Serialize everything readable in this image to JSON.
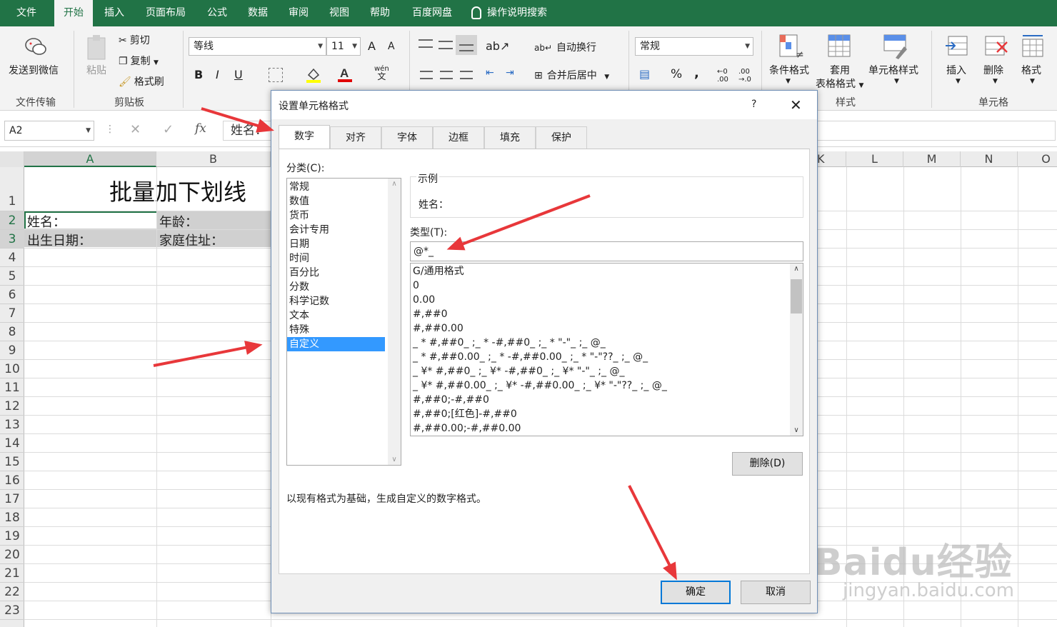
{
  "ribbon_tabs": [
    "文件",
    "开始",
    "插入",
    "页面布局",
    "公式",
    "数据",
    "审阅",
    "视图",
    "帮助",
    "百度网盘"
  ],
  "search_label": "操作说明搜索",
  "groups": {
    "file_transfer": {
      "button": "发送到微信",
      "label": "文件传输"
    },
    "clipboard": {
      "paste": "粘贴",
      "cut": "剪切",
      "copy": "复制",
      "format_painter": "格式刷",
      "label": "剪贴板"
    },
    "font": {
      "name": "等线",
      "size": "11",
      "bold": "B",
      "italic": "I",
      "underline": "U",
      "grow": "A",
      "shrink": "A",
      "wen": "wén",
      "wen2": "文"
    },
    "alignment": {
      "wrap": "自动换行",
      "merge": "合并后居中"
    },
    "number": {
      "format": "常规",
      "percent": "%",
      "comma": ","
    },
    "styles": {
      "conditional": "条件格式",
      "table1": "套用",
      "table2": "表格格式",
      "cell_styles": "单元格样式",
      "label": "样式"
    },
    "cells": {
      "insert": "插入",
      "delete": "删除",
      "format": "格式",
      "label": "单元格"
    }
  },
  "formula_bar": {
    "name_box": "A2",
    "fx": "fx",
    "content": "姓名："
  },
  "columns": [
    "A",
    "B",
    "K",
    "L",
    "M",
    "N",
    "O"
  ],
  "rows": [
    "1",
    "2",
    "3",
    "4",
    "5",
    "6",
    "7",
    "8",
    "9",
    "10",
    "11",
    "12",
    "13",
    "14",
    "15",
    "16",
    "17",
    "18",
    "19",
    "20",
    "21",
    "22",
    "23"
  ],
  "cells": {
    "title": "批量加下划线",
    "a2": "姓名：",
    "b2": "年龄：",
    "a3": "出生日期：",
    "b3": "家庭住址："
  },
  "dialog": {
    "title": "设置单元格格式",
    "help": "?",
    "tabs": [
      "数字",
      "对齐",
      "字体",
      "边框",
      "填充",
      "保护"
    ],
    "category_label": "分类(C):",
    "categories": [
      "常规",
      "数值",
      "货币",
      "会计专用",
      "日期",
      "时间",
      "百分比",
      "分数",
      "科学记数",
      "文本",
      "特殊",
      "自定义"
    ],
    "sample_label": "示例",
    "sample_value": "姓名：",
    "type_label": "类型(T):",
    "type_value": "@*_",
    "formats": [
      "G/通用格式",
      "0",
      "0.00",
      "#,##0",
      "#,##0.00",
      "_ * #,##0_ ;_ * -#,##0_ ;_ * \"-\"_ ;_ @_",
      "_ * #,##0.00_ ;_ * -#,##0.00_ ;_ * \"-\"??_ ;_ @_",
      "_ ¥* #,##0_ ;_ ¥* -#,##0_ ;_ ¥* \"-\"_ ;_ @_",
      "_ ¥* #,##0.00_ ;_ ¥* -#,##0.00_ ;_ ¥* \"-\"??_ ;_ @_",
      "#,##0;-#,##0",
      "#,##0;[红色]-#,##0",
      "#,##0.00;-#,##0.00"
    ],
    "delete_button": "删除(D)",
    "description": "以现有格式为基础，生成自定义的数字格式。",
    "ok": "确定",
    "cancel": "取消"
  },
  "watermark": "Baidu经验",
  "watermark_url": "jingyan.baidu.com",
  "colors": {
    "excel_green": "#217346",
    "arrow": "#e8373a",
    "selection": "#3399ff",
    "accent_blue": "#0078d7"
  }
}
